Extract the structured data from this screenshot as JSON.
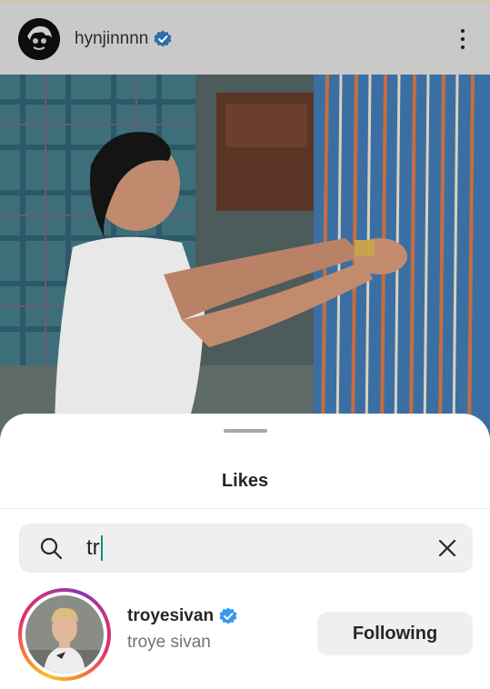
{
  "post": {
    "username": "hynjinnnn",
    "verified": true
  },
  "likes_sheet": {
    "title": "Likes",
    "search": {
      "value": "tr"
    },
    "results": [
      {
        "username": "troyesivan",
        "verified": true,
        "full_name": "troye sivan",
        "action_label": "Following",
        "has_story_ring": true
      }
    ]
  },
  "colors": {
    "verified_blue": "#3897f0",
    "story_ring": [
      "#f9c12b",
      "#f77737",
      "#e1306c",
      "#c13584",
      "#833ab4"
    ],
    "caret": "#128c7e"
  },
  "icons": [
    "more-options-icon",
    "verified-badge-icon",
    "search-icon",
    "clear-icon"
  ]
}
